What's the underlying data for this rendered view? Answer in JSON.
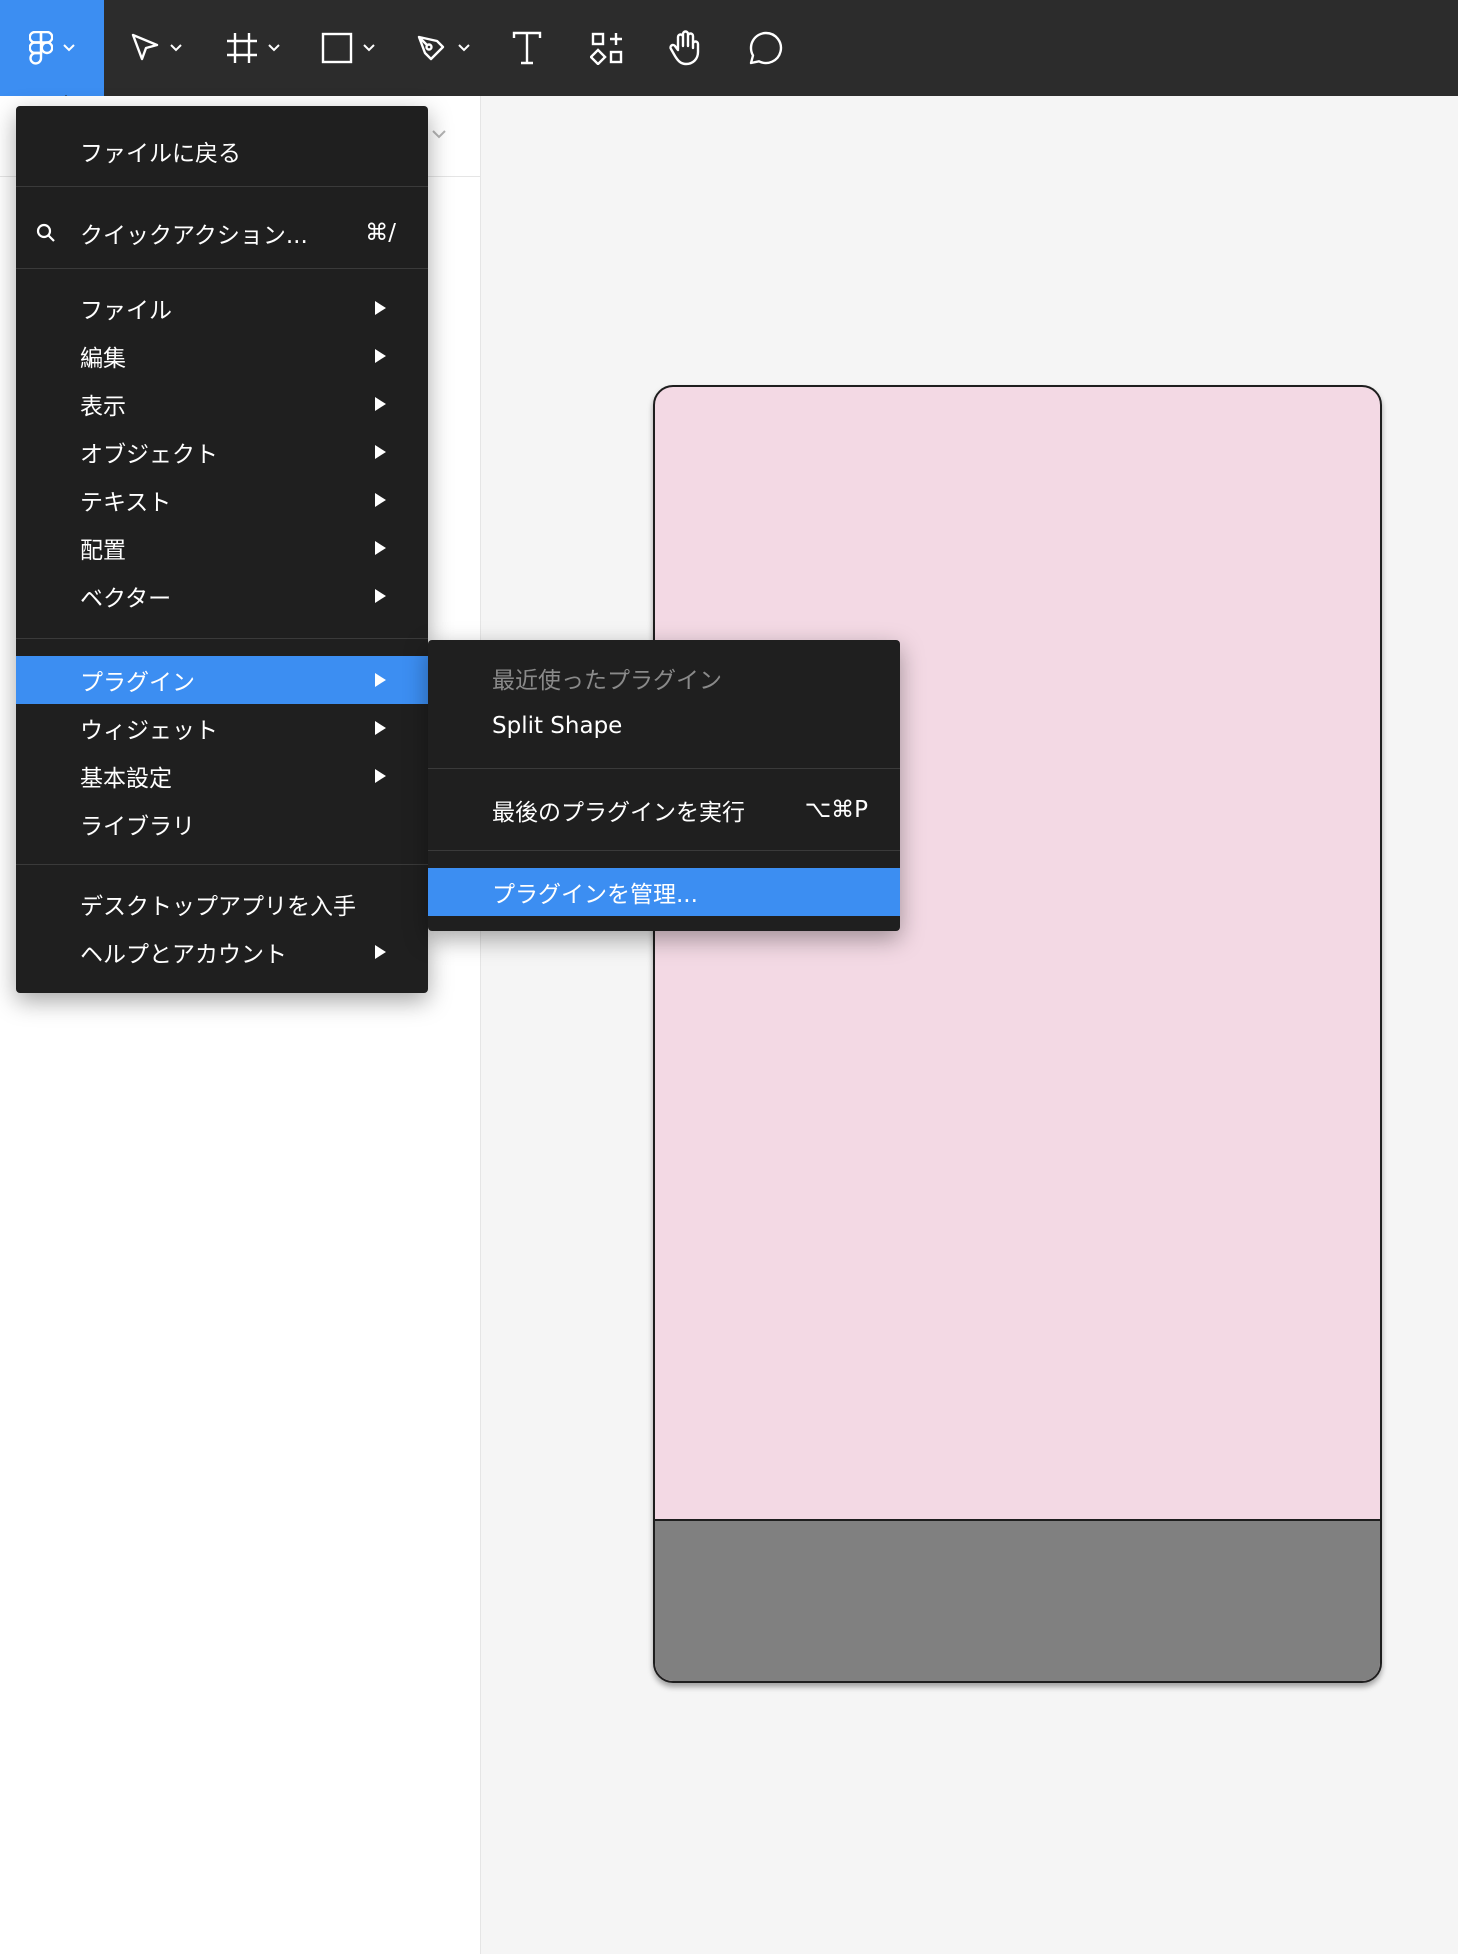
{
  "toolbar": {
    "tools": [
      {
        "icon": "figma-logo-icon"
      },
      {
        "icon": "move-tool-icon"
      },
      {
        "icon": "frame-tool-icon"
      },
      {
        "icon": "rectangle-tool-icon"
      },
      {
        "icon": "pen-tool-icon"
      },
      {
        "icon": "text-tool-icon"
      },
      {
        "icon": "resources-icon"
      },
      {
        "icon": "hand-tool-icon"
      },
      {
        "icon": "comment-icon"
      }
    ],
    "accent": "#3c8ef2",
    "background": "#2c2c2c"
  },
  "main_menu": {
    "back_to_files": "ファイルに戻る",
    "quick_actions": {
      "label": "クイックアクション...",
      "shortcut": "⌘/"
    },
    "items": [
      {
        "label": "ファイル",
        "submenu": true
      },
      {
        "label": "編集",
        "submenu": true
      },
      {
        "label": "表示",
        "submenu": true
      },
      {
        "label": "オブジェクト",
        "submenu": true
      },
      {
        "label": "テキスト",
        "submenu": true
      },
      {
        "label": "配置",
        "submenu": true
      },
      {
        "label": "ベクター",
        "submenu": true
      }
    ],
    "items2": [
      {
        "label": "プラグイン",
        "submenu": true,
        "highlighted": true
      },
      {
        "label": "ウィジェット",
        "submenu": true
      },
      {
        "label": "基本設定",
        "submenu": true
      },
      {
        "label": "ライブラリ",
        "submenu": false
      }
    ],
    "items3": [
      {
        "label": "デスクトップアプリを入手",
        "submenu": false
      },
      {
        "label": "ヘルプとアカウント",
        "submenu": true
      }
    ]
  },
  "plugins_submenu": {
    "recent_header": "最近使ったプラグイン",
    "recent_plugin": "Split Shape",
    "run_last": {
      "label": "最後のプラグインを実行",
      "shortcut": "⌥⌘P"
    },
    "manage": "プラグインを管理..."
  },
  "canvas": {
    "frame_fill": "#f3d9e4",
    "frame_bottom_fill": "#808080"
  }
}
